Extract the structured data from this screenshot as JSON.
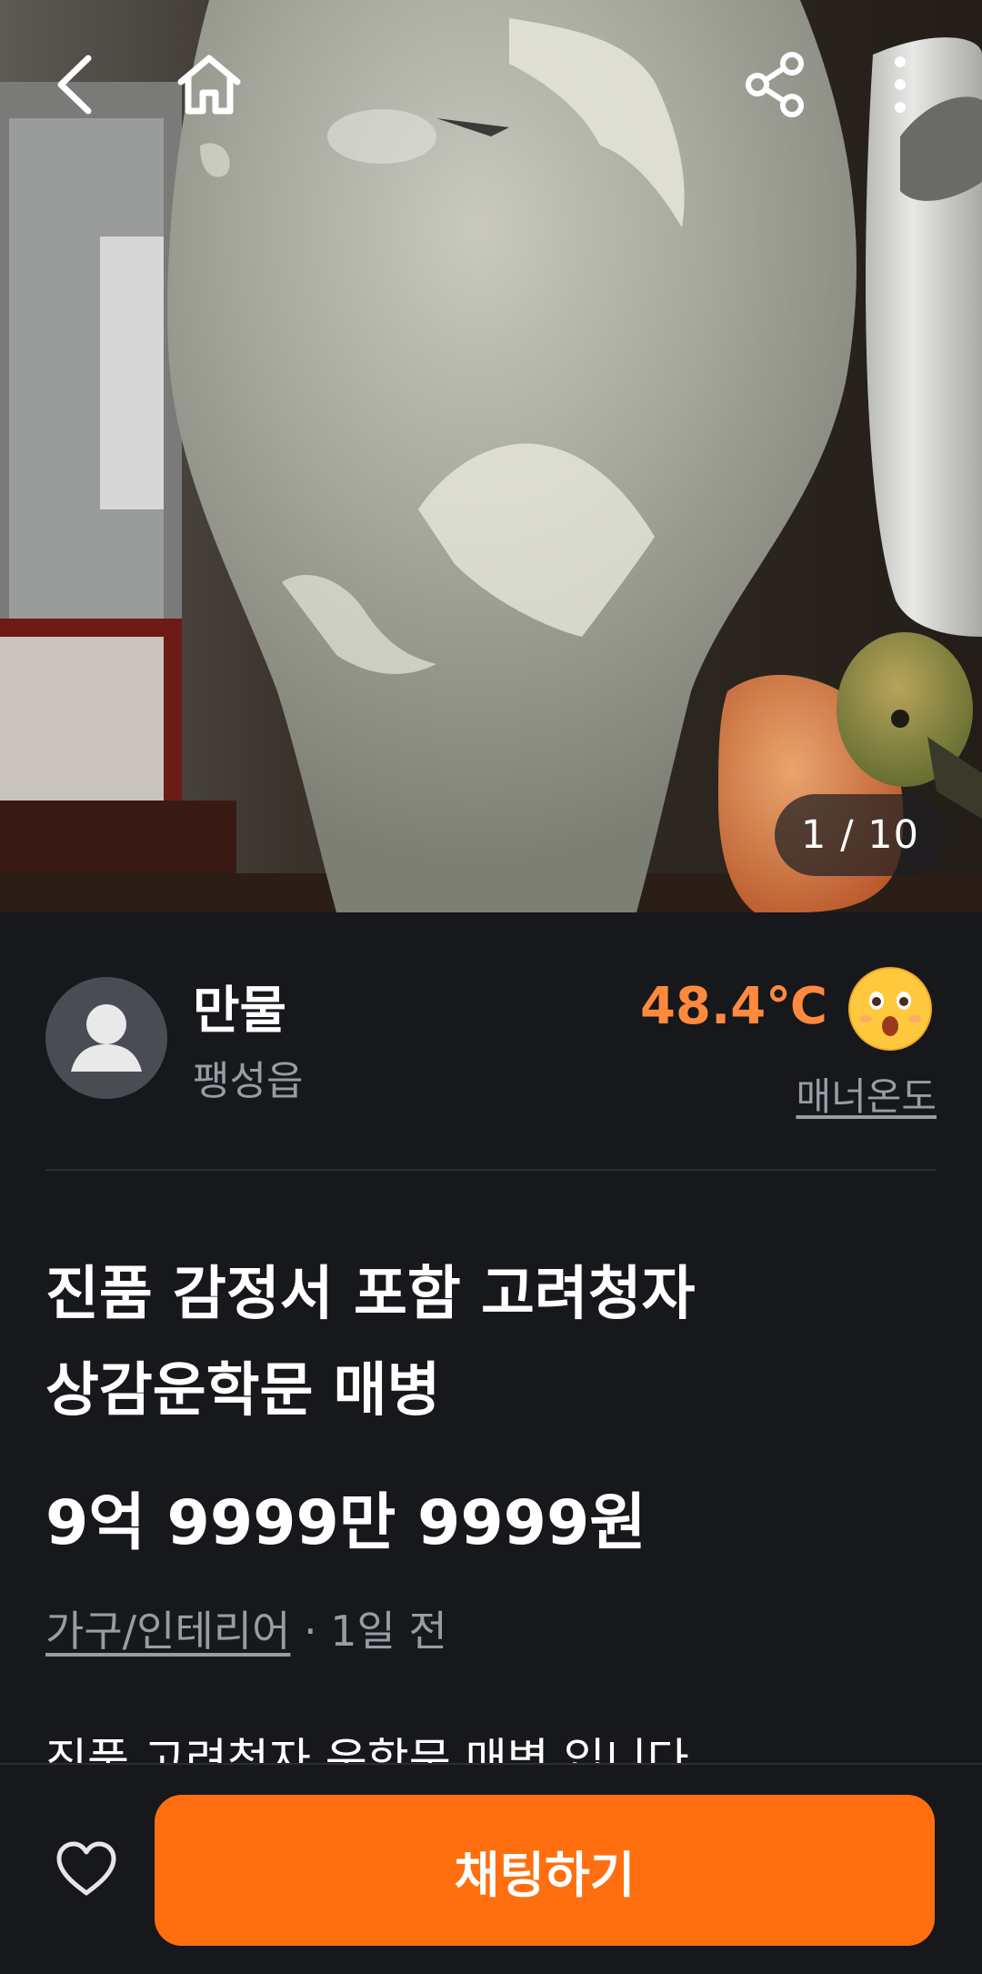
{
  "photo": {
    "counter": "1 / 10"
  },
  "topbar": {
    "back_icon": "chevron-left-icon",
    "home_icon": "home-icon",
    "share_icon": "share-icon",
    "more_icon": "more-vertical-icon"
  },
  "seller": {
    "name": "만물",
    "location": "팽성읍",
    "temperature": "48.4℃",
    "manner_label": "매너온도",
    "emoji_icon": "surprised-face-icon"
  },
  "product": {
    "title_line1": "진품 감정서 포함 고려청자",
    "title_line2": "상감운학문 매병",
    "price": "9억 9999만 9999원",
    "category": "가구/인테리어",
    "time": " · 1일 전",
    "description": "진품 고려청자 운학문 매병 입니다"
  },
  "actions": {
    "like_icon": "heart-outline-icon",
    "chat_label": "채팅하기"
  },
  "colors": {
    "accent": "#ff6f0f",
    "temperature": "#ff8a3d",
    "background": "#17181c"
  }
}
